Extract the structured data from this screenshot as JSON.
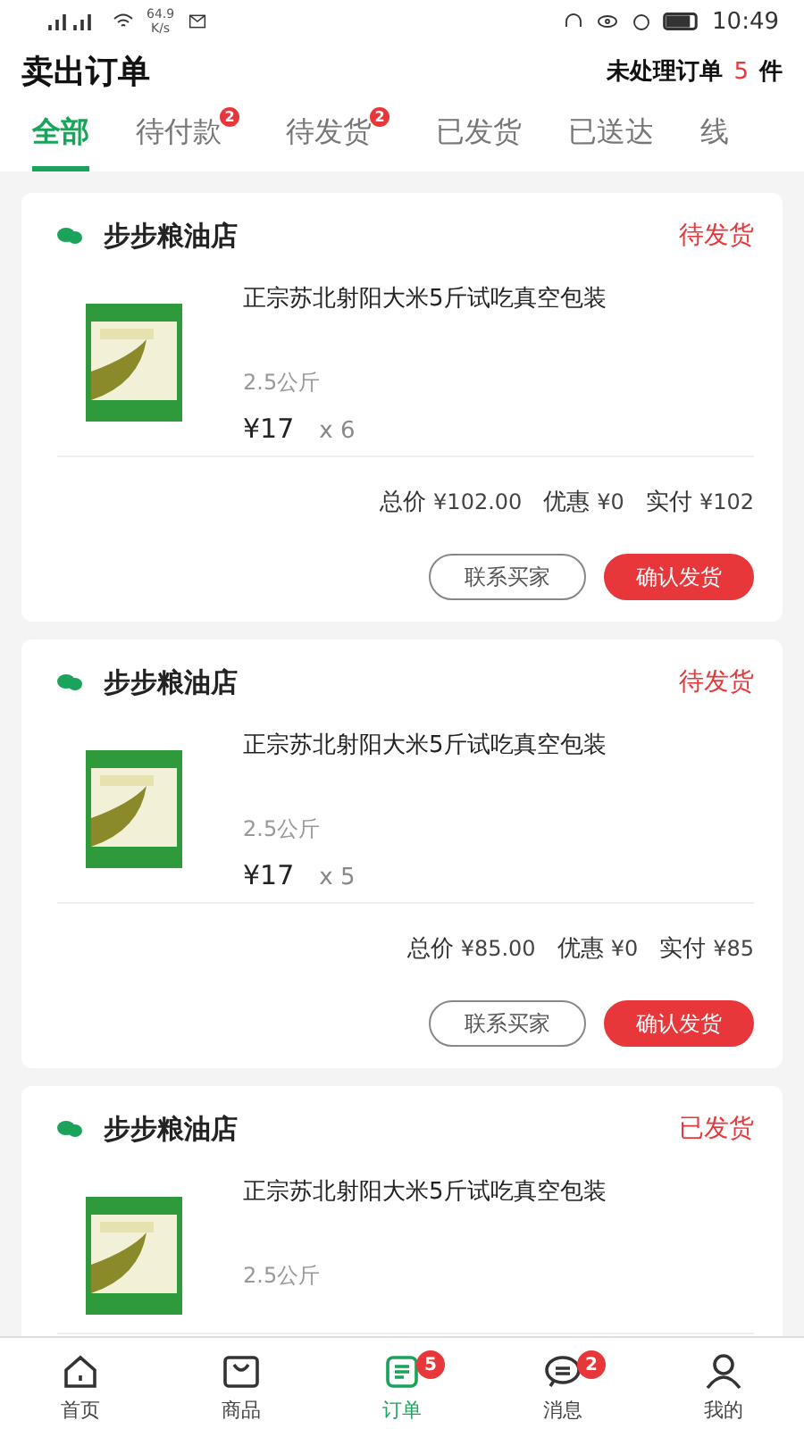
{
  "status_bar": {
    "net_speed": "64.9",
    "net_unit": "K/s",
    "time": "10:49"
  },
  "header": {
    "title": "卖出订单",
    "pending_label": "未处理订单",
    "pending_count": "5",
    "pending_unit": "件"
  },
  "tabs": [
    {
      "label": "全部",
      "selected": true
    },
    {
      "label": "待付款",
      "selected": false,
      "badge": "2"
    },
    {
      "label": "待发货",
      "selected": false,
      "badge": "2"
    },
    {
      "label": "已发货",
      "selected": false
    },
    {
      "label": "已送达",
      "selected": false
    },
    {
      "label": "线",
      "selected": false
    }
  ],
  "orders": [
    {
      "shop": "步步粮油店",
      "status": "待发货",
      "product": {
        "title": "正宗苏北射阳大米5斤试吃真空包装",
        "spec": "2.5公斤",
        "price": "¥17",
        "qty": "x 6"
      },
      "totals": [
        {
          "label": "总价",
          "value": "¥102.00"
        },
        {
          "label": "优惠",
          "value": "¥0"
        },
        {
          "label": "实付",
          "value": "¥102"
        }
      ],
      "buttons": [
        {
          "label": "联系买家",
          "kind": "outline"
        },
        {
          "label": "确认发货",
          "kind": "primary"
        }
      ]
    },
    {
      "shop": "步步粮油店",
      "status": "待发货",
      "product": {
        "title": "正宗苏北射阳大米5斤试吃真空包装",
        "spec": "2.5公斤",
        "price": "¥17",
        "qty": "x 5"
      },
      "totals": [
        {
          "label": "总价",
          "value": "¥85.00"
        },
        {
          "label": "优惠",
          "value": "¥0"
        },
        {
          "label": "实付",
          "value": "¥85"
        }
      ],
      "buttons": [
        {
          "label": "联系买家",
          "kind": "outline"
        },
        {
          "label": "确认发货",
          "kind": "primary"
        }
      ]
    },
    {
      "shop": "步步粮油店",
      "status": "已发货",
      "product": {
        "title": "正宗苏北射阳大米5斤试吃真空包装",
        "spec": "2.5公斤"
      }
    }
  ],
  "nav": [
    {
      "label": "首页",
      "selected": false
    },
    {
      "label": "商品",
      "selected": false
    },
    {
      "label": "订单",
      "selected": true,
      "badge": "5"
    },
    {
      "label": "消息",
      "selected": false,
      "badge": "2"
    },
    {
      "label": "我的",
      "selected": false
    }
  ]
}
